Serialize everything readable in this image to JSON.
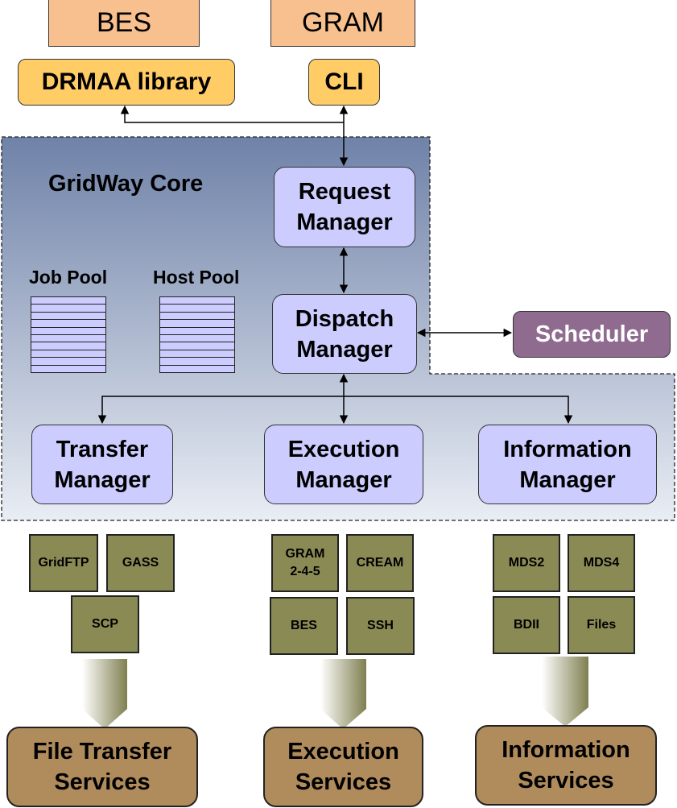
{
  "top_standards": [
    "BES",
    "GRAM"
  ],
  "interfaces": [
    "DRMAA library",
    "CLI"
  ],
  "core": {
    "title": "GridWay Core",
    "job_pool": "Job Pool",
    "host_pool": "Host Pool",
    "request_manager": [
      "Request",
      "Manager"
    ],
    "dispatch_manager": [
      "Dispatch",
      "Manager"
    ],
    "transfer_manager": [
      "Transfer",
      "Manager"
    ],
    "execution_manager": [
      "Execution",
      "Manager"
    ],
    "information_manager": [
      "Information",
      "Manager"
    ]
  },
  "scheduler": "Scheduler",
  "middleware": {
    "transfer": [
      "GridFTP",
      "GASS",
      "SCP"
    ],
    "execution": [
      "GRAM",
      "2-4-5",
      "CREAM",
      "BES",
      "SSH"
    ],
    "information": [
      "MDS2",
      "MDS4",
      "BDII",
      "Files"
    ]
  },
  "services": {
    "file_transfer": [
      "File Transfer",
      "Services"
    ],
    "execution": [
      "Execution",
      "Services"
    ],
    "information": [
      "Information",
      "Services"
    ]
  },
  "colors": {
    "standard": "#f9c08f",
    "interface": "#ffcc66",
    "manager": "#ccccff",
    "scheduler": "#8f6b8f",
    "middleware": "#8a8a55",
    "service": "#b08b5c",
    "core_top": "#6f82a8",
    "core_bottom": "#e9edf4"
  }
}
